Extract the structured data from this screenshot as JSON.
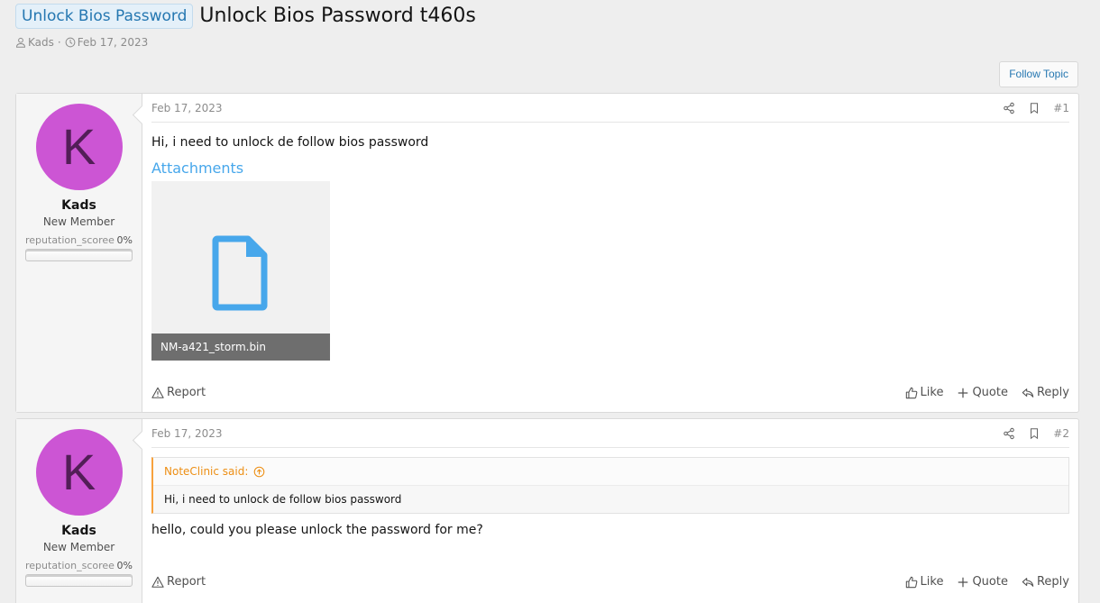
{
  "thread": {
    "prefix": "Unlock Bios Password",
    "title": "Unlock Bios Password t460s",
    "author": "Kads",
    "date": "Feb 17, 2023",
    "follow_label": "Follow Topic"
  },
  "posts": [
    {
      "user": {
        "avatar_letter": "K",
        "name": "Kads",
        "title": "New Member",
        "rep_label": "reputation_scoree",
        "rep_value": "0%"
      },
      "date": "Feb 17, 2023",
      "number": "#1",
      "text": "Hi, i need to unlock de follow bios password",
      "attachments_title": "Attachments",
      "attachment_name": "NM-a421_storm.bin",
      "report_label": "Report",
      "like_label": "Like",
      "quote_label": "Quote",
      "reply_label": "Reply"
    },
    {
      "user": {
        "avatar_letter": "K",
        "name": "Kads",
        "title": "New Member",
        "rep_label": "reputation_scoree",
        "rep_value": "0%"
      },
      "date": "Feb 17, 2023",
      "number": "#2",
      "quote_author": "NoteClinic said:",
      "quote_text": "Hi, i need to unlock de follow bios password",
      "text": "hello, could you please unlock the password for me?",
      "report_label": "Report",
      "like_label": "Like",
      "quote_label": "Quote",
      "reply_label": "Reply"
    }
  ],
  "colors": {
    "accent": "#2577b1",
    "avatar_bg": "#cc55d4",
    "quote_accent": "#f7a13c",
    "attachment_icon": "#47a7eb"
  },
  "icons": [
    "user-icon",
    "clock-icon",
    "share-icon",
    "bookmark-icon",
    "warning-icon",
    "thumbs-up-icon",
    "plus-icon",
    "reply-icon",
    "file-icon",
    "arrow-up-circle-icon"
  ]
}
